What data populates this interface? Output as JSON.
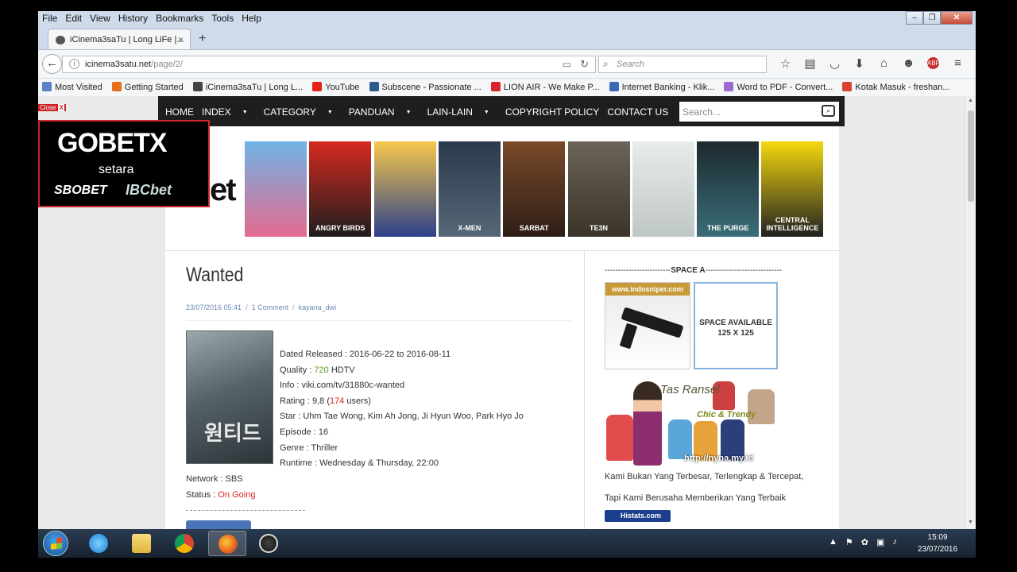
{
  "menubar": {
    "items": [
      "File",
      "Edit",
      "View",
      "History",
      "Bookmarks",
      "Tools",
      "Help"
    ]
  },
  "tab": {
    "title": "iCinema3saTu | Long LiFe |...",
    "close": "×",
    "new_tab": "+"
  },
  "navbar": {
    "url_host": "icinema3satu.net",
    "url_path": "/page/2/",
    "search_placeholder": "Search"
  },
  "bookmarks": [
    {
      "label": "Most Visited",
      "color": "#5b82c4"
    },
    {
      "label": "Getting Started",
      "color": "#e56f1b"
    },
    {
      "label": "iCinema3saTu | Long L...",
      "color": "#444444"
    },
    {
      "label": "YouTube",
      "color": "#e62117"
    },
    {
      "label": "Subscene - Passionate ...",
      "color": "#2c5b8f"
    },
    {
      "label": "LION AIR - We Make P...",
      "color": "#d9242b"
    },
    {
      "label": "Internet Banking - Klik...",
      "color": "#3968b4"
    },
    {
      "label": "Word to PDF - Convert...",
      "color": "#9c6bd1"
    },
    {
      "label": "Kotak Masuk - freshan...",
      "color": "#d8432f"
    }
  ],
  "site_nav": {
    "items": [
      {
        "label": "HOME",
        "caret": false
      },
      {
        "label": "INDEX",
        "caret": true
      },
      {
        "label": "CATEGORY",
        "caret": true
      },
      {
        "label": "PANDUAN",
        "caret": true
      },
      {
        "label": "LAIN-LAIN",
        "caret": true
      },
      {
        "label": "COPYRIGHT POLICY",
        "caret": false
      },
      {
        "label": "CONTACT US",
        "caret": false
      }
    ],
    "search_placeholder": "Search..."
  },
  "header": {
    "logo_fragment": "et",
    "posters": [
      {
        "title": "",
        "color_top": "#6fb3e6",
        "color_bottom": "#e46b8f"
      },
      {
        "title": "ANGRY BIRDS",
        "color_top": "#d62a20",
        "color_bottom": "#1d1d1d"
      },
      {
        "title": "",
        "color_top": "#f7c84b",
        "color_bottom": "#2b3f8a"
      },
      {
        "title": "X-MEN",
        "color_top": "#2a3a4c",
        "color_bottom": "#566776"
      },
      {
        "title": "SARBAT",
        "color_top": "#7a4a2a",
        "color_bottom": "#2d1d16"
      },
      {
        "title": "TE3N",
        "color_top": "#6a6556",
        "color_bottom": "#3b3328"
      },
      {
        "title": "",
        "color_top": "#e8ecea",
        "color_bottom": "#bfc7c5"
      },
      {
        "title": "THE PURGE",
        "color_top": "#1d2a2e",
        "color_bottom": "#3a6d79"
      },
      {
        "title": "CENTRAL INTELLIGENCE",
        "color_top": "#f5d90d",
        "color_bottom": "#202020"
      }
    ]
  },
  "article": {
    "title": "Wanted",
    "date": "23/07/2016 05:41",
    "comments": "1 Comment",
    "author": "kayana_dwi",
    "cover_text": "원티드",
    "dated_released": "Dated Released : 2016-06-22 to 2016-08-11",
    "quality_label": "Quality : ",
    "quality_value": "720",
    "quality_suffix": " HDTV",
    "info": "Info : viki.com/tv/31880c-wanted",
    "rating_prefix": "Rating : 9,8 (",
    "rating_users": "174",
    "rating_suffix": " users)",
    "star": "Star : Uhm Tae Wong, Kim Ah Jong, Ji Hyun Woo, Park Hyo Jo",
    "episode": "Episode : 16",
    "genre": "Genre : Thriller",
    "runtime": "Runtime : Wednesday & Thursday, 22:00",
    "network": "Network : SBS",
    "status_label": "Status : ",
    "status_value": "On Going"
  },
  "sidebar": {
    "space_title_left": "-------------------------",
    "space_title": "SPACE A",
    "space_title_right": "-----------------------------",
    "ad1_text": "www.indosniper.com",
    "ad2_line1": "SPACE AVAILABLE",
    "ad2_line2": "125 X 125",
    "ad3_text1": "Tas Ransel",
    "ad3_text2": "Chic & Trendy",
    "ad3_url": "http://nyna.my.id",
    "slogan1": "Kami Bukan Yang Terbesar, Terlengkap & Tercepat,",
    "slogan2": "Tapi Kami Berusaha Memberikan Yang Terbaik",
    "histats": "Histats.com"
  },
  "float_ad": {
    "close": "Close",
    "close_x": "X",
    "line1": "GOBETX",
    "line2": "setara",
    "line3": "SBOBET",
    "line4": "IBCbet"
  },
  "taskbar": {
    "time": "15:09",
    "date": "23/07/2016"
  }
}
